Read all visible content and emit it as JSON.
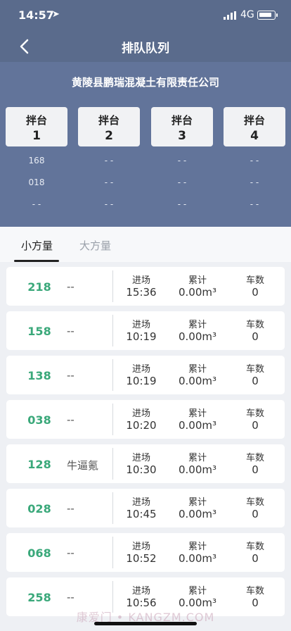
{
  "status": {
    "time": "14:57",
    "network": "4G",
    "location_icon": "location-arrow-icon",
    "signal_icon": "signal-bars-icon",
    "battery_icon": "battery-icon"
  },
  "nav": {
    "title": "排队队列",
    "back_icon": "chevron-left-icon"
  },
  "company": "黄陵县鹏瑞混凝土有限责任公司",
  "stations": [
    {
      "label": "拌台",
      "num": "1",
      "queue": [
        "168",
        "018",
        "- -"
      ]
    },
    {
      "label": "拌台",
      "num": "2",
      "queue": [
        "- -",
        "- -",
        "- -"
      ]
    },
    {
      "label": "拌台",
      "num": "3",
      "queue": [
        "- -",
        "- -",
        "- -"
      ]
    },
    {
      "label": "拌台",
      "num": "4",
      "queue": [
        "- -",
        "- -",
        "- -"
      ]
    }
  ],
  "tabs": [
    {
      "label": "小方量",
      "active": true
    },
    {
      "label": "大方量",
      "active": false
    }
  ],
  "columns": {
    "entry": "进场",
    "total": "累计",
    "trips": "车数"
  },
  "rows": [
    {
      "code": "218",
      "name": "--",
      "entry": "15:36",
      "total": "0.00m³",
      "trips": "0"
    },
    {
      "code": "158",
      "name": "--",
      "entry": "10:19",
      "total": "0.00m³",
      "trips": "0"
    },
    {
      "code": "138",
      "name": "--",
      "entry": "10:19",
      "total": "0.00m³",
      "trips": "0"
    },
    {
      "code": "038",
      "name": "--",
      "entry": "10:20",
      "total": "0.00m³",
      "trips": "0"
    },
    {
      "code": "128",
      "name": "牛逼氪",
      "entry": "10:30",
      "total": "0.00m³",
      "trips": "0"
    },
    {
      "code": "028",
      "name": "--",
      "entry": "10:45",
      "total": "0.00m³",
      "trips": "0"
    },
    {
      "code": "068",
      "name": "--",
      "entry": "10:52",
      "total": "0.00m³",
      "trips": "0"
    },
    {
      "code": "258",
      "name": "--",
      "entry": "10:56",
      "total": "0.00m³",
      "trips": "0"
    }
  ],
  "watermark": "康爱门 • KANGZM.COM",
  "colors": {
    "header": "#5a6b8c",
    "band": "#62749a",
    "accent_green": "#3aa87a"
  }
}
